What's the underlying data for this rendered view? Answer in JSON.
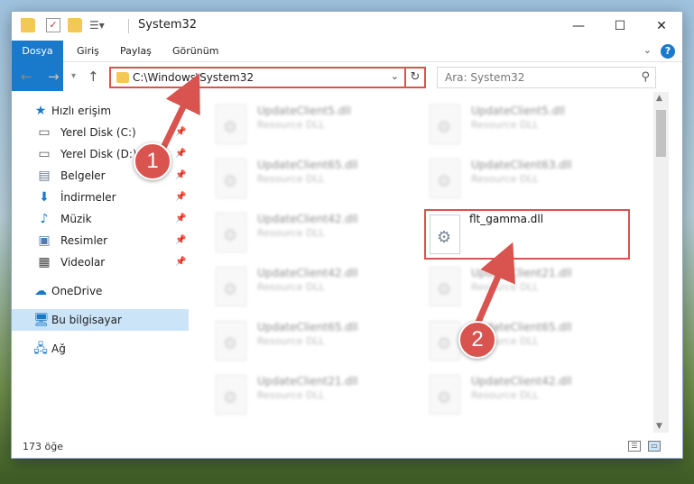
{
  "window": {
    "title": "System32"
  },
  "ribbon": {
    "tabs": [
      "Dosya",
      "Giriş",
      "Paylaş",
      "Görünüm"
    ],
    "help": "?"
  },
  "address": {
    "path": "C:\\Windows\\System32"
  },
  "search": {
    "placeholder": "Ara: System32"
  },
  "sidebar": {
    "quick_access": "Hızlı erişim",
    "items": [
      {
        "label": "Yerel Disk (C:)",
        "icon": "drive-icon"
      },
      {
        "label": "Yerel Disk (D:)",
        "icon": "drive-icon"
      },
      {
        "label": "Belgeler",
        "icon": "documents-icon"
      },
      {
        "label": "İndirmeler",
        "icon": "downloads-icon"
      },
      {
        "label": "Müzik",
        "icon": "music-icon"
      },
      {
        "label": "Resimler",
        "icon": "pictures-icon"
      },
      {
        "label": "Videolar",
        "icon": "videos-icon"
      }
    ],
    "onedrive": "OneDrive",
    "this_pc": "Bu bilgisayar",
    "network": "Ağ"
  },
  "files": {
    "left": [
      {
        "name": "UpdateClient5.dll",
        "type": "Resource DLL"
      },
      {
        "name": "UpdateClient65.dll",
        "type": "Resource DLL"
      },
      {
        "name": "UpdateClient42.dll",
        "type": "Resource DLL"
      },
      {
        "name": "UpdateClient42.dll",
        "type": "Resource DLL"
      },
      {
        "name": "UpdateClient65.dll",
        "type": "Resource DLL"
      },
      {
        "name": "UpdateClient21.dll",
        "type": "Resource DLL"
      }
    ],
    "right": [
      {
        "name": "UpdateClient5.dll",
        "type": "Resource DLL"
      },
      {
        "name": "UpdateClient63.dll",
        "type": "Resource DLL"
      },
      {
        "name": "flt_gamma.dll",
        "type": ""
      },
      {
        "name": "UpdateClient21.dll",
        "type": "Resource DLL"
      },
      {
        "name": "UpdateClient65.dll",
        "type": "Resource DLL"
      },
      {
        "name": "UpdateClient42.dll",
        "type": "Resource DLL"
      }
    ]
  },
  "status": {
    "count": "173 öğe"
  },
  "callouts": {
    "one": "1",
    "two": "2"
  },
  "colors": {
    "accent": "#1979ca",
    "highlight": "#d9534f",
    "selected": "#cce4f7"
  }
}
